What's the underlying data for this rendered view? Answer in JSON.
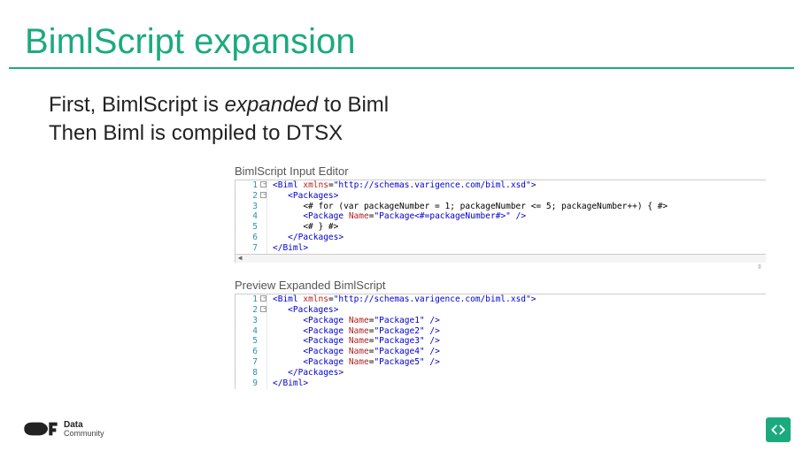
{
  "title": "BimlScript expansion",
  "body": {
    "line1a": "First, BimlScript is ",
    "em": "expanded",
    "line1b": " to Biml",
    "line2": "Then Biml is compiled to DTSX"
  },
  "panels": [
    {
      "label": "BimlScript Input Editor",
      "xmlns": "\"http://schemas.varigence.com/biml.xsd\"",
      "lines": [
        {
          "n": "1"
        },
        {
          "n": "2"
        },
        {
          "n": "3",
          "code": "<# for (var packageNumber = 1; packageNumber <= 5; packageNumber++) { #>"
        },
        {
          "n": "4",
          "val": "\"Package<#=packageNumber#>\""
        },
        {
          "n": "5",
          "code": "<# } #>"
        },
        {
          "n": "6"
        },
        {
          "n": "7"
        }
      ]
    },
    {
      "label": "Preview Expanded BimlScript",
      "xmlns": "\"http://schemas.varigence.com/biml.xsd\"",
      "lines": [
        {
          "n": "1"
        },
        {
          "n": "2"
        },
        {
          "n": "3",
          "val": "\"Package1\""
        },
        {
          "n": "4",
          "val": "\"Package2\""
        },
        {
          "n": "5",
          "val": "\"Package3\""
        },
        {
          "n": "6",
          "val": "\"Package4\""
        },
        {
          "n": "7",
          "val": "\"Package5\""
        },
        {
          "n": "8"
        },
        {
          "n": "9"
        }
      ]
    }
  ],
  "logo": {
    "line1": "Data",
    "line2": "Community"
  },
  "colors": {
    "accent": "#1baa7e"
  }
}
